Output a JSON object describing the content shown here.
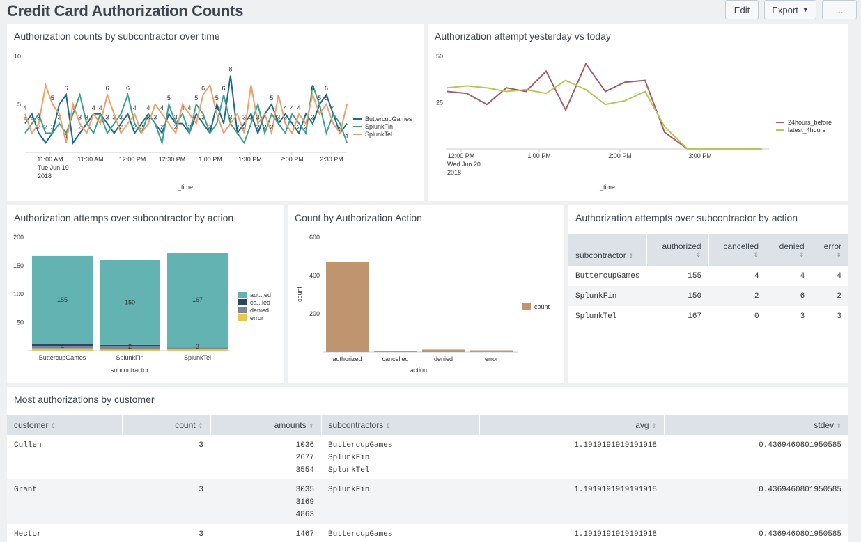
{
  "page": {
    "title": "Credit Card Authorization Counts",
    "buttons": {
      "edit": "Edit",
      "export": "Export",
      "more": "..."
    }
  },
  "panel1": {
    "title": "Authorization counts by subcontractor over time",
    "xlabel": "_time",
    "x_ticks": [
      "11:00 AM",
      "11:30 AM",
      "12:00 PM",
      "12:30 PM",
      "1:00 PM",
      "1:30 PM",
      "2:00 PM",
      "2:30 PM"
    ],
    "x_sub": [
      "Tue Jun 19",
      "2018"
    ],
    "y_ticks": [
      "10",
      "5"
    ],
    "legend": [
      "ButtercupGames",
      "SplunkFin",
      "SplunkTel"
    ],
    "colors": [
      "#1a6a8e",
      "#3fa08e",
      "#f09e6a"
    ]
  },
  "panel2": {
    "title": "Authorization attempt yesterday vs today",
    "xlabel": "_time",
    "x_ticks": [
      "12:00 PM",
      "1:00 PM",
      "2:00 PM",
      "3:00 PM"
    ],
    "x_sub": [
      "Wed Jun 20",
      "2018"
    ],
    "y_ticks": [
      "50",
      "25"
    ],
    "legend": [
      "24hours_before",
      "latest_4hours"
    ],
    "colors": [
      "#a65c63",
      "#b6c75a"
    ]
  },
  "panel3": {
    "title": "Authorization attemps over subcontractor by action",
    "xlabel": "subcontractor",
    "y_ticks": [
      "200",
      "150",
      "100",
      "50"
    ],
    "legend": [
      "aut...ed",
      "ca...led",
      "denied",
      "error"
    ],
    "colors": [
      "#62b3b2",
      "#2b4563",
      "#7a8799",
      "#e8c650"
    ]
  },
  "panel4": {
    "title": "Count by Authorization Action",
    "xlabel": "action",
    "ylabel": "count",
    "y_ticks": [
      "600",
      "400",
      "200"
    ],
    "legend": [
      "count"
    ],
    "color": "#bf9570"
  },
  "panel5": {
    "title": "Authorization attempts over subcontractor by action",
    "columns": [
      "subcontractor",
      "authorized",
      "cancelled",
      "denied",
      "error"
    ],
    "rows": [
      [
        "ButtercupGames",
        "155",
        "4",
        "4",
        "4"
      ],
      [
        "SplunkFin",
        "150",
        "2",
        "6",
        "2"
      ],
      [
        "SplunkTel",
        "167",
        "0",
        "3",
        "3"
      ]
    ]
  },
  "panel6": {
    "title": "Most authorizations by customer",
    "columns": [
      "customer",
      "count",
      "amounts",
      "subcontractors",
      "avg",
      "stdev"
    ],
    "rows": [
      {
        "customer": "Cullen",
        "count": "3",
        "amounts": [
          "1036",
          "2677",
          "3554"
        ],
        "subcontractors": [
          "ButtercupGames",
          "SplunkFin",
          "SplunkTel"
        ],
        "avg": "1.1919191919191918",
        "stdev": "0.4369460801950585"
      },
      {
        "customer": "Grant",
        "count": "3",
        "amounts": [
          "3035",
          "3169",
          "4863"
        ],
        "subcontractors": [
          "SplunkFin"
        ],
        "avg": "1.1919191919191918",
        "stdev": "0.4369460801950585"
      },
      {
        "customer": "Hector",
        "count": "3",
        "amounts": [
          "1467"
        ],
        "subcontractors": [
          "ButtercupGames"
        ],
        "avg": "1.1919191919191918",
        "stdev": "0.4369460801950585"
      }
    ]
  },
  "chart_data": [
    {
      "type": "line",
      "title": "Authorization counts by subcontractor over time",
      "xlabel": "_time",
      "ylim": [
        0,
        10
      ],
      "series": [
        {
          "name": "ButtercupGames",
          "values": [
            3,
            4,
            2,
            1,
            2,
            5,
            6,
            1,
            2,
            3,
            4,
            4,
            3,
            2,
            3,
            4,
            2,
            3,
            4,
            3,
            2,
            4,
            3,
            3,
            2,
            4,
            3,
            2,
            5,
            3,
            8,
            2,
            3,
            4,
            2,
            4,
            5,
            3,
            4,
            3,
            2,
            4,
            3,
            5,
            6,
            4,
            2,
            3
          ]
        },
        {
          "name": "SplunkFin",
          "values": [
            2,
            3,
            4,
            2,
            2,
            3,
            2,
            4,
            6,
            3,
            2,
            4,
            2,
            3,
            4,
            6,
            3,
            2,
            4,
            3,
            1,
            5,
            3,
            4,
            2,
            5,
            4,
            2,
            3,
            6,
            3,
            2,
            1,
            3,
            5,
            2,
            4,
            3,
            2,
            4,
            3,
            2,
            7,
            5,
            2,
            4,
            3,
            1
          ]
        },
        {
          "name": "SplunkTel",
          "values": [
            4,
            2,
            3,
            7,
            5,
            4,
            1,
            5,
            3,
            2,
            4,
            3,
            6,
            4,
            2,
            3,
            4,
            2,
            3,
            5,
            4,
            3,
            2,
            5,
            4,
            3,
            6,
            7,
            4,
            2,
            3,
            4,
            2,
            7,
            3,
            4,
            2,
            6,
            3,
            2,
            4,
            3,
            6,
            4,
            5,
            3,
            2,
            5
          ]
        }
      ]
    },
    {
      "type": "line",
      "title": "Authorization attempt yesterday vs today",
      "xlabel": "_time",
      "ylim": [
        0,
        50
      ],
      "series": [
        {
          "name": "24hours_before",
          "values": [
            31,
            30,
            24,
            33,
            31,
            42,
            21,
            46,
            31,
            36,
            37,
            9,
            0,
            0,
            0,
            0,
            0
          ]
        },
        {
          "name": "latest_4hours",
          "values": [
            33,
            34,
            33,
            31,
            32,
            30,
            37,
            32,
            24,
            26,
            31,
            12,
            0,
            0,
            0,
            0,
            0
          ]
        }
      ]
    },
    {
      "type": "bar",
      "title": "Authorization attemps over subcontractor by action",
      "xlabel": "subcontractor",
      "categories": [
        "ButtercupGames",
        "SplunkFin",
        "SplunkTel"
      ],
      "ylim": [
        0,
        200
      ],
      "stacked": true,
      "series": [
        {
          "name": "aut...ed",
          "values": [
            155,
            150,
            167
          ]
        },
        {
          "name": "ca...led",
          "values": [
            4,
            2,
            0
          ]
        },
        {
          "name": "denied",
          "values": [
            4,
            6,
            3
          ]
        },
        {
          "name": "error",
          "values": [
            4,
            2,
            3
          ]
        }
      ]
    },
    {
      "type": "bar",
      "title": "Count by Authorization Action",
      "xlabel": "action",
      "ylabel": "count",
      "categories": [
        "authorized",
        "cancelled",
        "denied",
        "error"
      ],
      "values": [
        472,
        6,
        13,
        9
      ],
      "ylim": [
        0,
        600
      ]
    }
  ]
}
